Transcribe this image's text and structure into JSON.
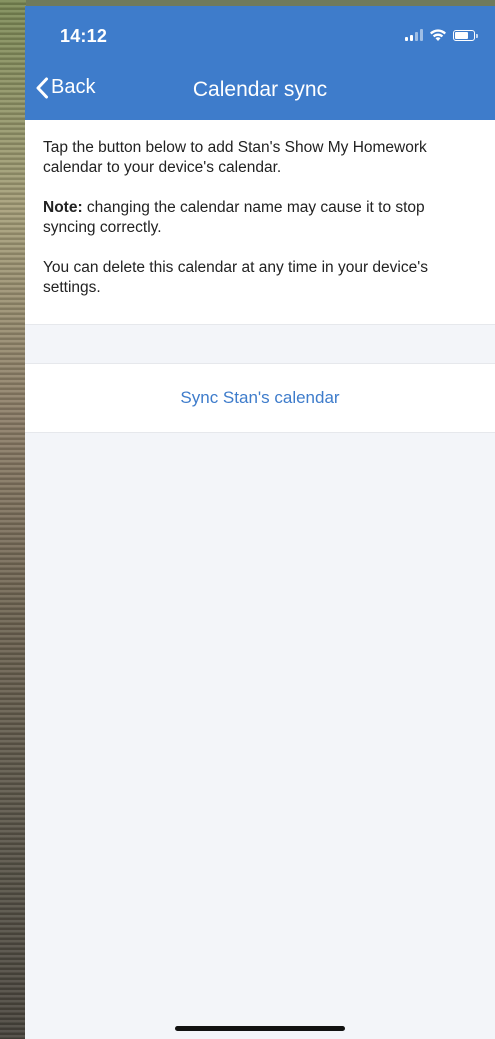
{
  "status_bar": {
    "time": "14:12",
    "icons": [
      "signal-icon",
      "wifi-icon",
      "battery-icon"
    ]
  },
  "nav": {
    "back_label": "Back",
    "title": "Calendar sync",
    "background_color": "#3e7ccb"
  },
  "info": {
    "paragraph_1": "Tap the button below to add Stan's Show My Homework calendar to your device's calendar.",
    "note_label": "Note:",
    "note_text": " changing the calendar name may cause it to stop syncing correctly.",
    "paragraph_3": "You can delete this calendar at any time in your device's settings."
  },
  "actions": {
    "sync_label": "Sync Stan's calendar",
    "accent_color": "#3e7ccb"
  }
}
